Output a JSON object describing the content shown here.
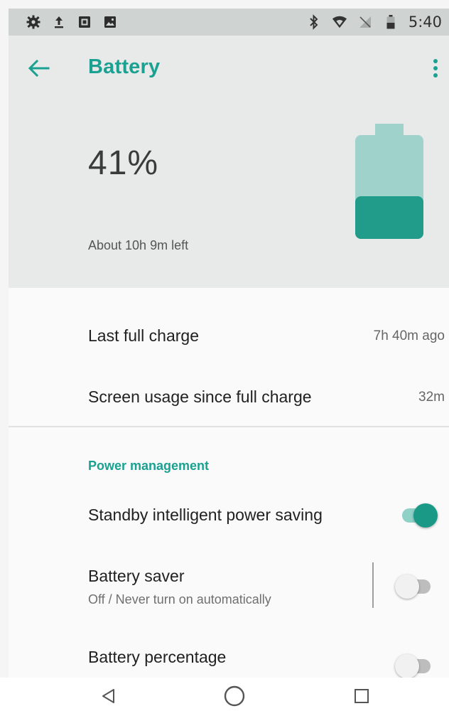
{
  "status_bar": {
    "time": "5:40",
    "left_icons": [
      "gear-icon",
      "upload-icon",
      "photo-icon",
      "image-icon"
    ],
    "right_icons": [
      "bluetooth-icon",
      "wifi-icon",
      "no-sim-icon",
      "battery-icon"
    ]
  },
  "header": {
    "title": "Battery",
    "battery_percent": "41%",
    "remaining": "About 10h 9m left",
    "battery_level": 0.41
  },
  "usage": [
    {
      "label": "Last full charge",
      "value": "7h 40m ago"
    },
    {
      "label": "Screen usage since full charge",
      "value": "32m"
    }
  ],
  "power_management": {
    "title": "Power management",
    "items": [
      {
        "label": "Standby intelligent power saving",
        "summary": "",
        "checked": true
      },
      {
        "label": "Battery saver",
        "summary": "Off / Never turn on automatically",
        "checked": false
      },
      {
        "label": "Battery percentage",
        "summary": "",
        "checked": false
      }
    ]
  },
  "colors": {
    "accent": "#1aa192",
    "battery_fill": "#229c8a",
    "battery_empty": "#9ed2cb"
  }
}
